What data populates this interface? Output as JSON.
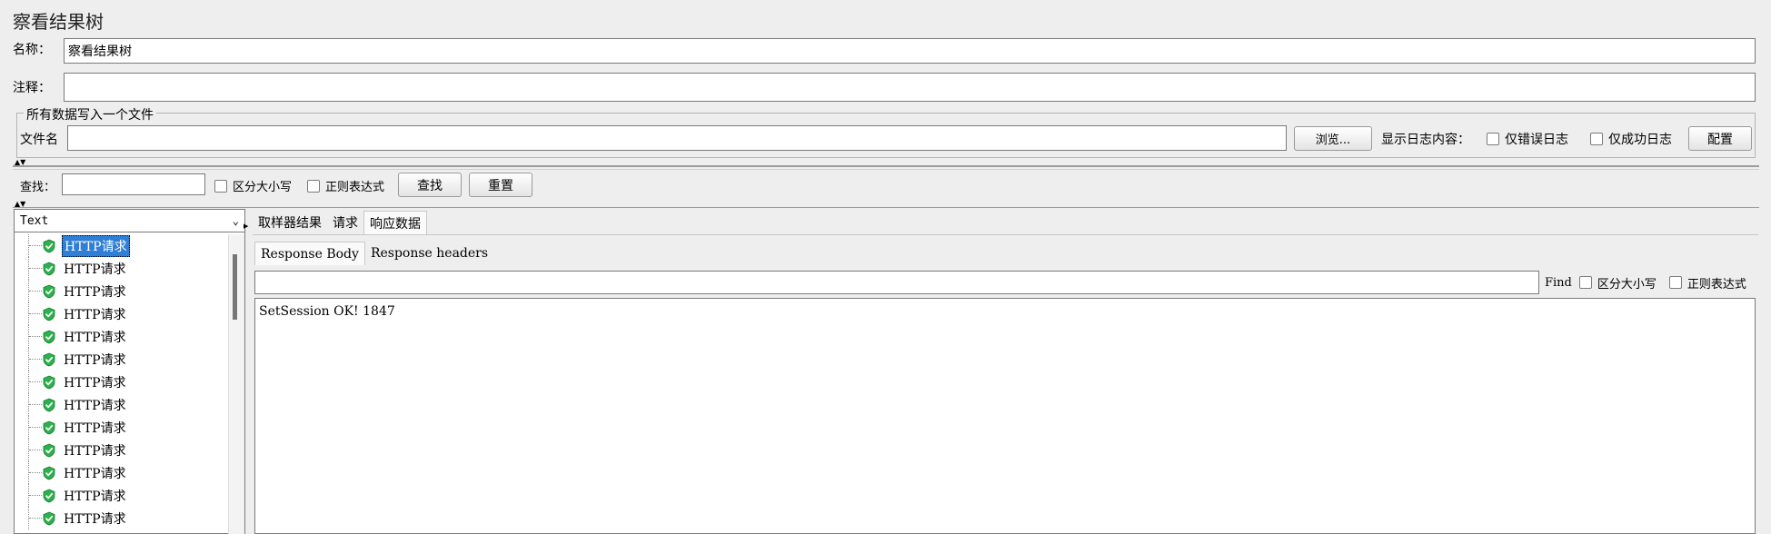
{
  "window": {
    "title": "察看结果树"
  },
  "form": {
    "name_label": "名称：",
    "name_value": "察看结果树",
    "comment_label": "注释："
  },
  "file_group": {
    "legend": "所有数据写入一个文件",
    "filename_label": "文件名",
    "browse_button": "浏览...",
    "log_label": "显示日志内容：",
    "errors_only": "仅错误日志",
    "success_only": "仅成功日志",
    "config_button": "配置"
  },
  "search": {
    "label": "查找：",
    "case_sensitive": "区分大小写",
    "regex": "正则表达式",
    "find_button": "查找",
    "reset_button": "重置"
  },
  "renderer": {
    "selected": "Text"
  },
  "tree": {
    "items": [
      "HTTP请求",
      "HTTP请求",
      "HTTP请求",
      "HTTP请求",
      "HTTP请求",
      "HTTP请求",
      "HTTP请求",
      "HTTP请求",
      "HTTP请求",
      "HTTP请求",
      "HTTP请求",
      "HTTP请求",
      "HTTP请求"
    ]
  },
  "result_tabs": [
    "取样器结果",
    "请求",
    "响应数据"
  ],
  "response_tabs": [
    "Response Body",
    "Response headers"
  ],
  "response_find": {
    "label": "Find",
    "case_sensitive": "区分大小写",
    "regex": "正则表达式"
  },
  "response_body": "SetSession OK! 1847",
  "colors": {
    "success_icon": "#2bb24c",
    "selected_bg": "#2f7fd6"
  }
}
